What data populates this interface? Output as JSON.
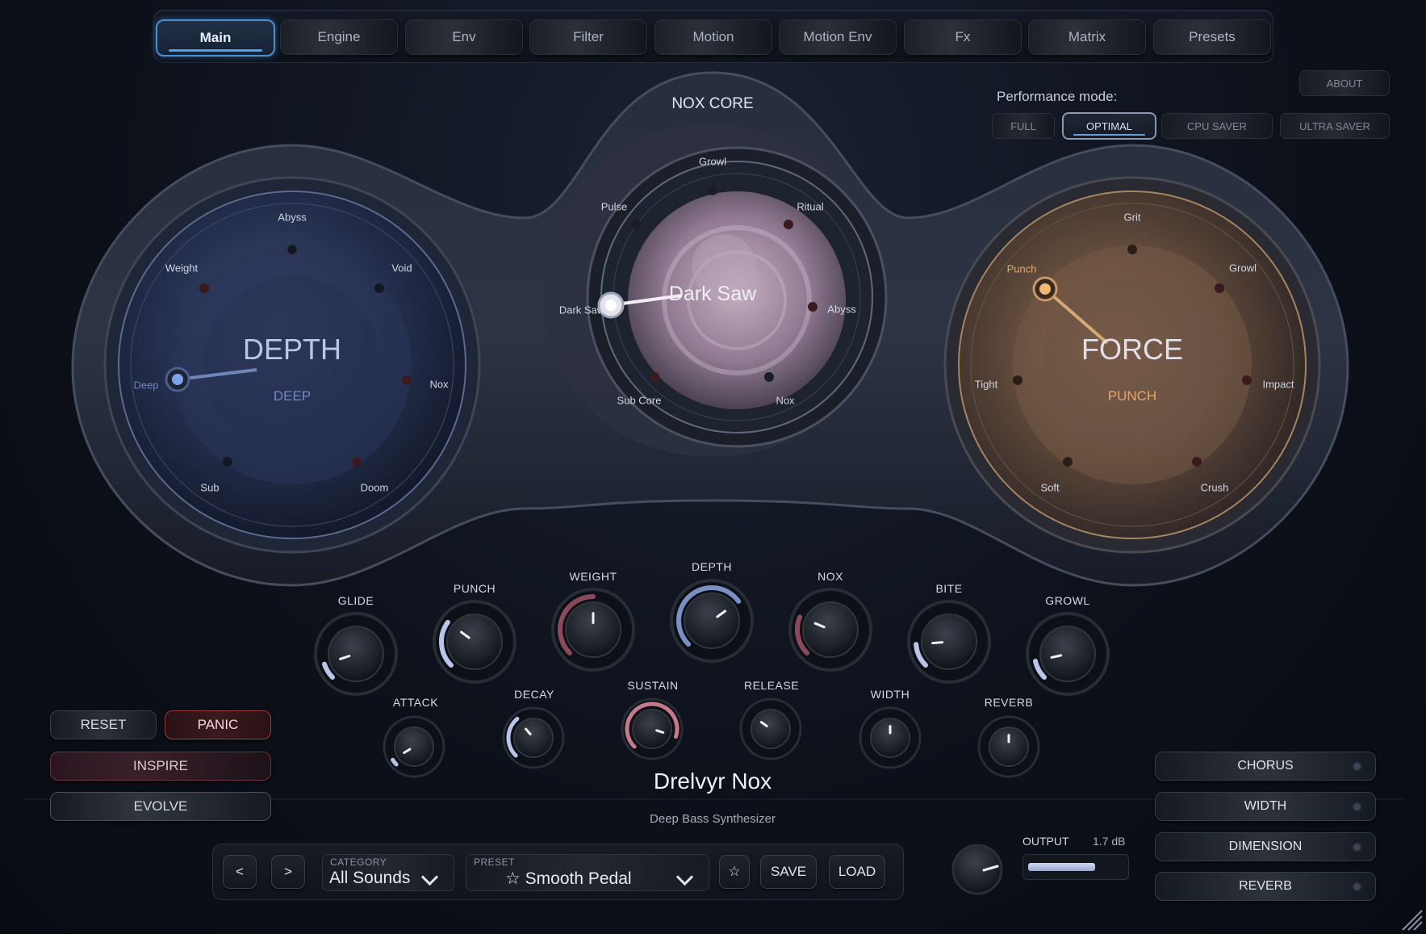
{
  "tabs": [
    {
      "label": "Main",
      "active": true
    },
    {
      "label": "Engine"
    },
    {
      "label": "Env"
    },
    {
      "label": "Filter"
    },
    {
      "label": "Motion"
    },
    {
      "label": "Motion Env"
    },
    {
      "label": "Fx"
    },
    {
      "label": "Matrix"
    },
    {
      "label": "Presets"
    }
  ],
  "about_label": "ABOUT",
  "performance": {
    "label": "Performance mode:",
    "options": [
      "FULL",
      "OPTIMAL",
      "CPU SAVER",
      "ULTRA SAVER"
    ],
    "selected": "OPTIMAL"
  },
  "core": {
    "title": "NOX CORE",
    "value": "Dark Saw",
    "positions": [
      "Growl",
      "Ritual",
      "Abyss",
      "Nox",
      "Sub Core",
      "Dark Saw",
      "Pulse"
    ]
  },
  "depth_dial": {
    "title": "DEPTH",
    "value": "DEEP",
    "positions": [
      "Abyss",
      "Void",
      "Nox",
      "Doom",
      "Sub",
      "Deep",
      "Weight"
    ],
    "accent": "#6c86c6"
  },
  "force_dial": {
    "title": "FORCE",
    "value": "PUNCH",
    "positions": [
      "Grit",
      "Growl",
      "Impact",
      "Crush",
      "Soft",
      "Tight",
      "Punch"
    ],
    "accent": "#e0a060"
  },
  "knobs_top": [
    {
      "label": "GLIDE",
      "value": 0.1
    },
    {
      "label": "PUNCH",
      "value": 0.3
    },
    {
      "label": "WEIGHT",
      "value": 0.5
    },
    {
      "label": "DEPTH",
      "value": 0.7
    },
    {
      "label": "NOX",
      "value": 0.25
    },
    {
      "label": "BITE",
      "value": 0.15
    },
    {
      "label": "GROWL",
      "value": 0.12
    }
  ],
  "knobs_bottom": [
    {
      "label": "ATTACK",
      "value": 0.05
    },
    {
      "label": "DECAY",
      "value": 0.35
    },
    {
      "label": "SUSTAIN",
      "value": 0.9
    },
    {
      "label": "RELEASE",
      "value": 0.3
    },
    {
      "label": "WIDTH",
      "value": 0.5
    },
    {
      "label": "REVERB",
      "value": 0.5
    }
  ],
  "left_buttons": {
    "reset": "RESET",
    "panic": "PANIC",
    "inspire": "INSPIRE",
    "evolve": "EVOLVE"
  },
  "product": {
    "name": "Drelvyr Nox",
    "subtitle": "Deep Bass Synthesizer"
  },
  "fx_buttons": [
    "CHORUS",
    "WIDTH",
    "DIMENSION",
    "REVERB"
  ],
  "preset_bar": {
    "prev": "<",
    "next": ">",
    "category_caption": "CATEGORY",
    "category_value": "All Sounds",
    "preset_caption": "PRESET",
    "preset_value": "☆ Smooth Pedal",
    "fav": "☆",
    "save": "SAVE",
    "load": "LOAD"
  },
  "output": {
    "label": "OUTPUT",
    "value": "1.7 dB",
    "level": 0.7
  }
}
